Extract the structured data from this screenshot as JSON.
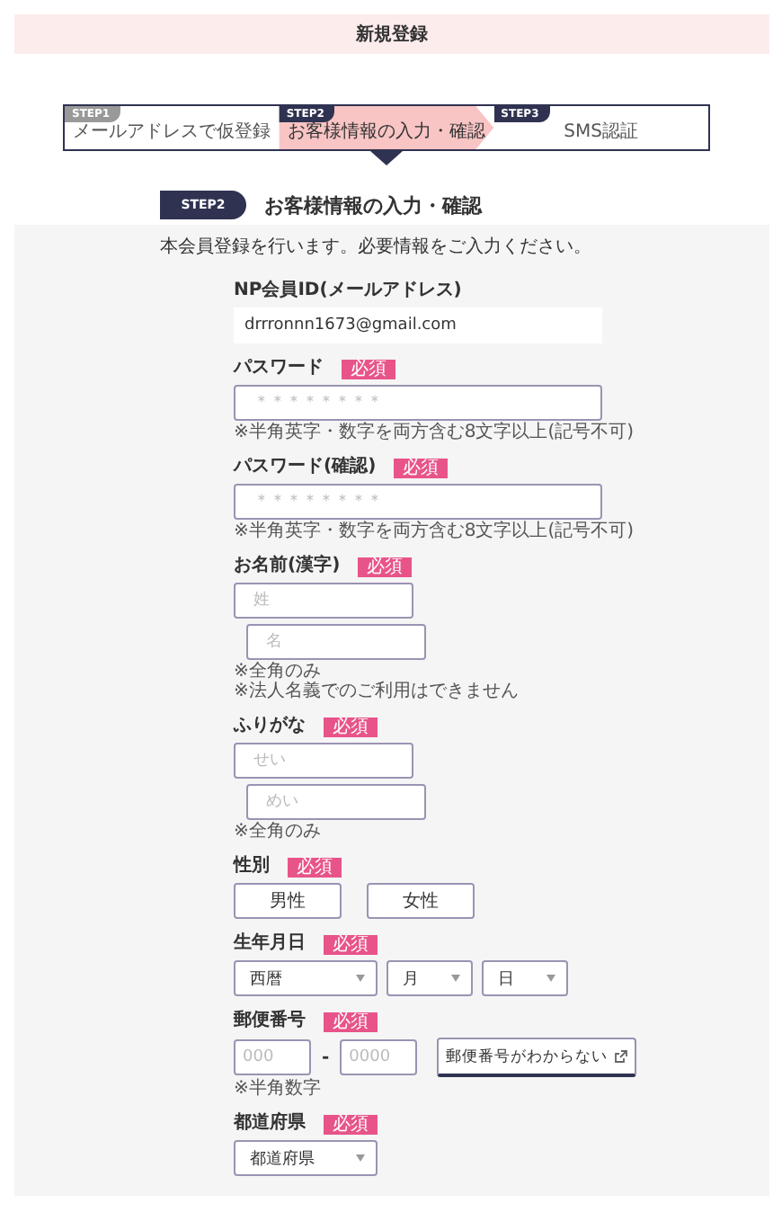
{
  "header": {
    "title": "新規登録"
  },
  "steps": [
    {
      "badge": "STEP1",
      "label": "メールアドレスで仮登録",
      "selected": false
    },
    {
      "badge": "STEP2",
      "label": "お客様情報の入力・確認",
      "selected": true
    },
    {
      "badge": "STEP3",
      "label": "SMS認証",
      "selected": false
    }
  ],
  "section": {
    "badge": "STEP2",
    "title": "お客様情報の入力・確認"
  },
  "intro": "本会員登録を行います。必要情報をご入力ください。",
  "fields": [
    {
      "kind": "static",
      "label": "NP会員ID(メールアドレス)",
      "value": "drrronnn1673@gmail.com"
    },
    {
      "kind": "text",
      "label": "パスワード",
      "badge": "必須",
      "inputs": [
        {
          "placeholder": "＊＊＊＊＊＊＊＊"
        }
      ],
      "notes": [
        "※半角英字・数字を両方含む8文字以上(記号不可)"
      ]
    },
    {
      "kind": "text",
      "label": "パスワード(確認)",
      "badge": "必須",
      "inputs": [
        {
          "placeholder": "＊＊＊＊＊＊＊＊"
        }
      ],
      "notes": [
        "※半角英字・数字を両方含む8文字以上(記号不可)"
      ]
    },
    {
      "kind": "pair",
      "label": "お名前(漢字)",
      "badge": "必須",
      "inputs": [
        {
          "placeholder": "姓"
        },
        {
          "placeholder": "名"
        }
      ],
      "notes": [
        "※全角のみ",
        "※法人名義でのご利用はできません"
      ]
    },
    {
      "kind": "pair",
      "label": "ふりがな",
      "badge": "必須",
      "inputs": [
        {
          "placeholder": "せい"
        },
        {
          "placeholder": "めい"
        }
      ],
      "notes": [
        "※全角のみ"
      ]
    },
    {
      "kind": "choice",
      "label": "性別",
      "badge": "必須",
      "options": [
        {
          "label": "男性",
          "selected": false
        },
        {
          "label": "女性",
          "selected": false
        }
      ]
    },
    {
      "kind": "select",
      "label": "生年月日",
      "badge": "必須",
      "selects": [
        {
          "value": "西暦"
        },
        {
          "value": "月"
        },
        {
          "value": "日"
        }
      ]
    },
    {
      "kind": "postal",
      "label": "郵便番号",
      "badge": "必須",
      "inputs": [
        {
          "placeholder": "000"
        },
        {
          "placeholder": "0000"
        }
      ],
      "separator": "-",
      "button": "郵便番号がわからない",
      "notes": [
        "※半角数字"
      ]
    },
    {
      "kind": "select",
      "label": "都道府県",
      "badge": "必須",
      "selects": [
        {
          "value": "都道府県"
        }
      ]
    }
  ]
}
